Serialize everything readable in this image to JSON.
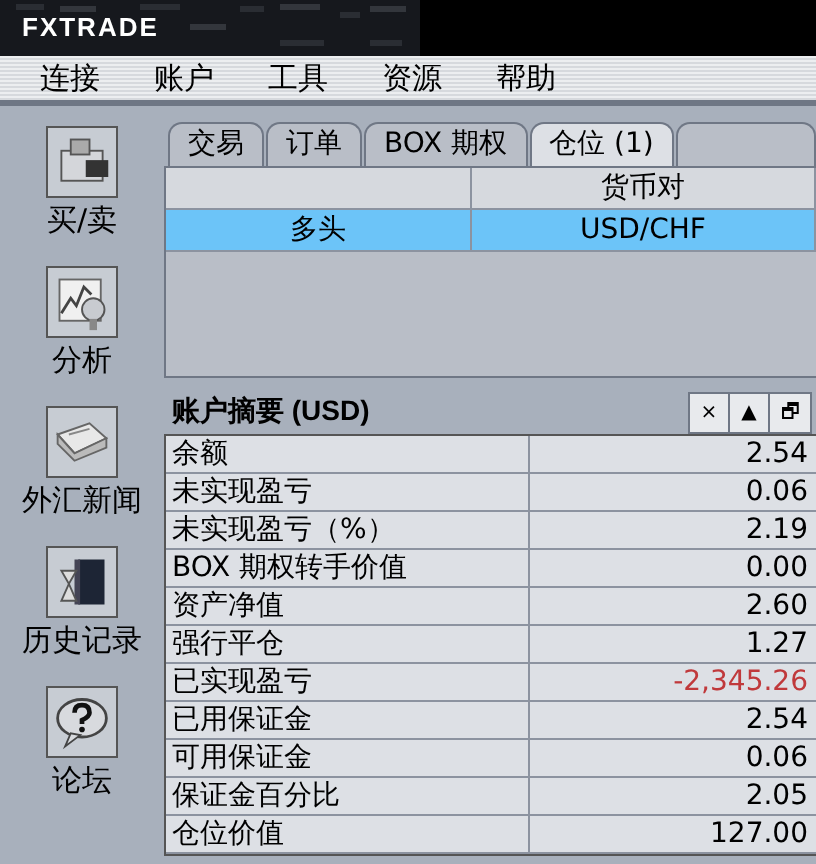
{
  "header": {
    "logo": "FXTRADE"
  },
  "menu": [
    "连接",
    "账户",
    "工具",
    "资源",
    "帮助"
  ],
  "sidebar": [
    {
      "kind": "trade",
      "label": "买/卖"
    },
    {
      "kind": "chart",
      "label": "分析"
    },
    {
      "kind": "news",
      "label": "外汇新闻"
    },
    {
      "kind": "history",
      "label": "历史记录"
    },
    {
      "kind": "forum",
      "label": "论坛"
    }
  ],
  "tabs": [
    {
      "label": "交易",
      "selected": false
    },
    {
      "label": "订单",
      "selected": false
    },
    {
      "label": "BOX 期权",
      "selected": false
    },
    {
      "label": "仓位 (1)",
      "selected": true
    },
    {
      "selected": false
    }
  ],
  "positions": {
    "columns": [
      {
        "kind": "blank"
      },
      {
        "kind": "text",
        "label": "货币对"
      }
    ],
    "rows": [
      {
        "cells": [
          "多头",
          "USD/CHF"
        ],
        "selected": true
      }
    ]
  },
  "summary": {
    "title": "账户摘要 (USD)",
    "buttons": [
      "×",
      "▲",
      "🗗"
    ],
    "rows": [
      {
        "label": "余额",
        "value": "2.54",
        "negative": false
      },
      {
        "label": "未实现盈亏",
        "value": "0.06",
        "negative": false
      },
      {
        "label": "未实现盈亏（%）",
        "value": "2.19",
        "negative": false
      },
      {
        "label": "BOX 期权转手价值",
        "value": "0.00",
        "negative": false
      },
      {
        "label": "资产净值",
        "value": "2.60",
        "negative": false
      },
      {
        "label": "强行平仓",
        "value": "1.27",
        "negative": false
      },
      {
        "label": "已实现盈亏",
        "value": "-2,345.26",
        "negative": true
      },
      {
        "label": "已用保证金",
        "value": "2.54",
        "negative": false
      },
      {
        "label": "可用保证金",
        "value": "0.06",
        "negative": false
      },
      {
        "label": "保证金百分比",
        "value": "2.05",
        "negative": false
      },
      {
        "label": "仓位价值",
        "value": "127.00",
        "negative": false
      }
    ]
  }
}
